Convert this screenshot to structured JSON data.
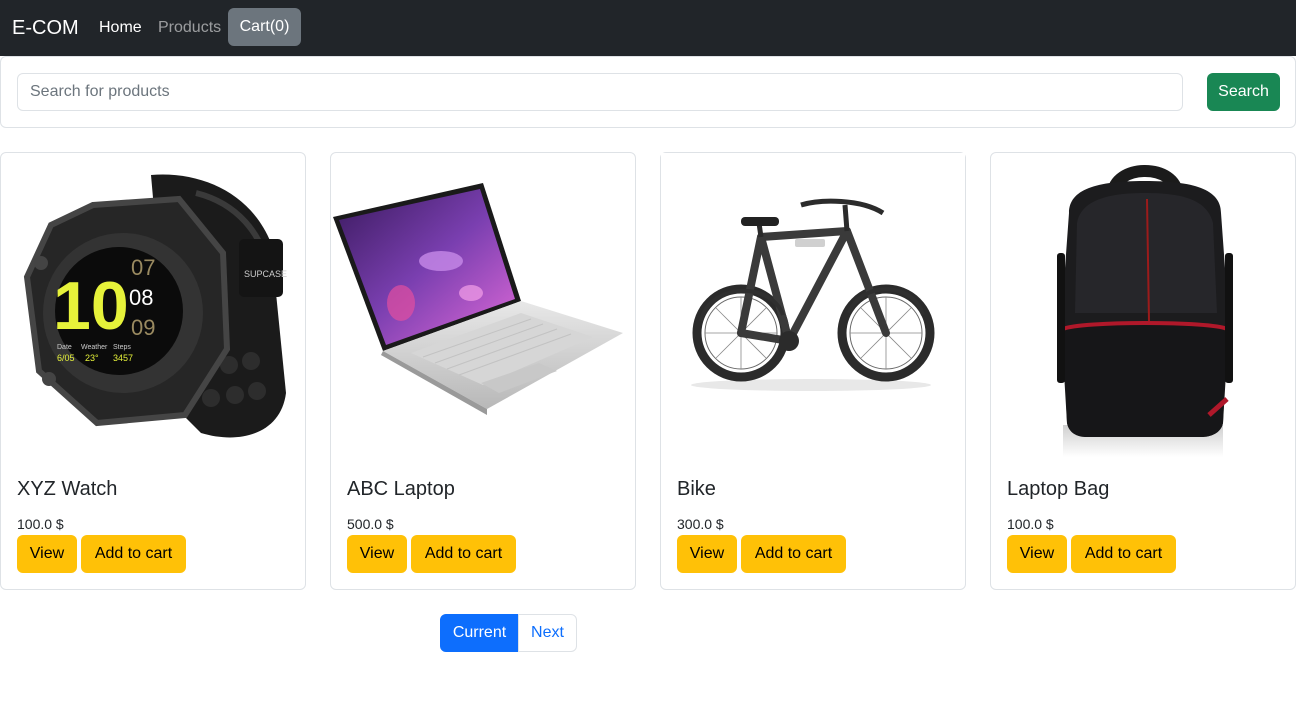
{
  "navbar": {
    "brand": "E-COM",
    "links": [
      {
        "label": "Home"
      },
      {
        "label": "Products"
      }
    ],
    "cart_label": "Cart(0)"
  },
  "search": {
    "placeholder": "Search for products",
    "value": "",
    "button_label": "Search"
  },
  "products": [
    {
      "name": "XYZ Watch",
      "price": "100.0 $",
      "view_label": "View",
      "add_label": "Add to cart",
      "image": "smartwatch-icon"
    },
    {
      "name": "ABC Laptop",
      "price": "500.0 $",
      "view_label": "View",
      "add_label": "Add to cart",
      "image": "laptop-icon"
    },
    {
      "name": "Bike",
      "price": "300.0 $",
      "view_label": "View",
      "add_label": "Add to cart",
      "image": "bicycle-icon"
    },
    {
      "name": "Laptop Bag",
      "price": "100.0 $",
      "view_label": "View",
      "add_label": "Add to cart",
      "image": "backpack-icon"
    }
  ],
  "pagination": {
    "current_label": "Current",
    "next_label": "Next"
  },
  "colors": {
    "navbar_bg": "#212529",
    "cart_button": "#6c757d",
    "search_button": "#198754",
    "warning_button": "#ffc107",
    "primary": "#0d6efd"
  }
}
